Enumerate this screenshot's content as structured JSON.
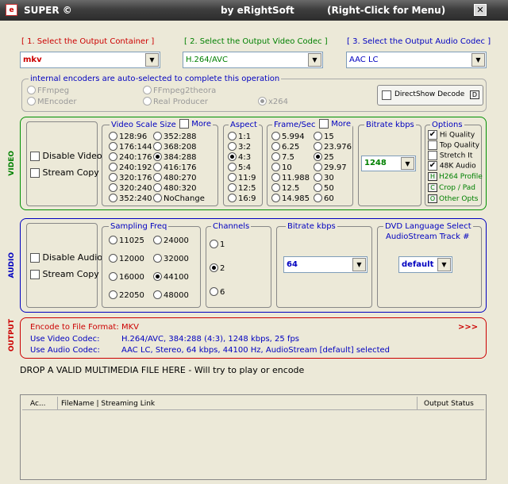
{
  "window": {
    "app_title": "SUPER ©",
    "publisher": "by eRightSoft",
    "hint": "(Right-Click for Menu)",
    "icon_letter": "e"
  },
  "step1": {
    "label": "[ 1.    Select the Output Container ]",
    "value": "mkv"
  },
  "step2": {
    "label": "[ 2.   Select the Output Video Codec ]",
    "value": "H.264/AVC"
  },
  "step3": {
    "label": "[ 3.   Select the Output Audio Codec ]",
    "value": "AAC LC"
  },
  "encoders": {
    "note": "internal encoders are auto-selected to complete this operation",
    "ffmpeg": "FFmpeg",
    "ffmpeg2theora": "FFmpeg2theora",
    "mencoder": "MEncoder",
    "realproducer": "Real Producer",
    "x264": "x264",
    "directshow": "DirectShow Decode",
    "directshow_btn": "D"
  },
  "video": {
    "section_label": "VIDEO",
    "disable": "Disable Video",
    "stream_copy": "Stream Copy",
    "scale_title": "Video Scale Size",
    "scale_more": "More",
    "scale_col1": [
      "128:96",
      "176:144",
      "240:176",
      "240:192",
      "320:176",
      "320:240",
      "352:240"
    ],
    "scale_col2": [
      "352:288",
      "368:208",
      "384:288",
      "416:176",
      "480:270",
      "480:320",
      "NoChange"
    ],
    "aspect_title": "Aspect",
    "aspects": [
      "1:1",
      "3:2",
      "4:3",
      "5:4",
      "11:9",
      "12:5",
      "16:9"
    ],
    "fps_title": "Frame/Sec",
    "fps_more": "More",
    "fps_col1": [
      "5.994",
      "6.25",
      "7.5",
      "10",
      "11.988",
      "12.5",
      "14.985"
    ],
    "fps_col2": [
      "15",
      "23.976",
      "25",
      "29.97",
      "30",
      "50",
      "60"
    ],
    "bitrate_title": "Bitrate  kbps",
    "bitrate_value": "1248",
    "options_title": "Options",
    "hi_quality": "Hi Quality",
    "top_quality": "Top Quality",
    "stretch": "Stretch It",
    "audio48k": "48K Audio",
    "h264_profile": "H264 Profile",
    "h264_btn": "H",
    "crop_pad": "Crop / Pad",
    "crop_btn": "C",
    "other_opts": "Other Opts",
    "other_btn": "O"
  },
  "audio": {
    "section_label": "AUDIO",
    "disable": "Disable Audio",
    "stream_copy": "Stream Copy",
    "freq_title": "Sampling Freq",
    "freq_col1": [
      "11025",
      "12000",
      "16000",
      "22050"
    ],
    "freq_col2": [
      "24000",
      "32000",
      "44100",
      "48000"
    ],
    "channels_title": "Channels",
    "channels": [
      "1",
      "2",
      "6"
    ],
    "bitrate_title": "Bitrate  kbps",
    "bitrate_value": "64",
    "dvd_title": "DVD Language Select",
    "dvd_subtitle": "AudioStream  Track #",
    "dvd_value": "default"
  },
  "output": {
    "section_label": "OUTPUT",
    "format_label": "Encode to File Format:",
    "format_value": "MKV",
    "arrows": ">>>",
    "video_label": "Use Video Codec:",
    "video_value": "H.264/AVC,  384:288 (4:3),  1248 kbps,  25 fps",
    "audio_label": "Use Audio Codec:",
    "audio_value": "AAC LC,  Stereo,  64 kbps,  44100 Hz,  AudioStream [default] selected"
  },
  "drop_text": "DROP A VALID MULTIMEDIA FILE HERE - Will try to play or encode",
  "table": {
    "col_active": "Ac...",
    "col_filename": "FileName  |  Streaming Link",
    "col_status": "Output Status"
  }
}
